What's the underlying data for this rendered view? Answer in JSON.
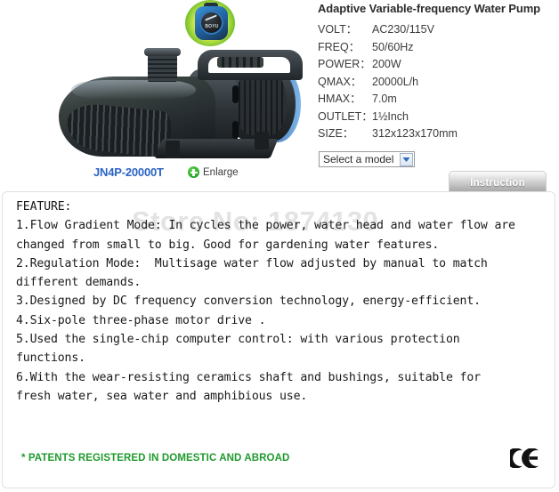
{
  "product": {
    "model": "JN4P-20000T",
    "enlarge_label": "Enlarge",
    "enlarge_icon": "plus-circle-icon",
    "image_alt": "black-water-pump-with-blue-accents",
    "badge_logo": "BOYU"
  },
  "specs": {
    "title": "Adaptive Variable-frequency Water Pump",
    "rows": [
      {
        "key": "VOLT：",
        "value": "AC230/115V"
      },
      {
        "key": "FREQ：",
        "value": "50/60Hz"
      },
      {
        "key": "POWER：",
        "value": "200W"
      },
      {
        "key": "QMAX：",
        "value": "20000L/h"
      },
      {
        "key": "HMAX：",
        "value": "7.0m"
      },
      {
        "key": "OUTLET：",
        "value": "1½Inch"
      },
      {
        "key": "SIZE：",
        "value": "312x123x170mm"
      }
    ]
  },
  "model_select": {
    "value": "Select a model",
    "arrow_icon": "chevron-down-icon",
    "options": [
      "Select a model"
    ]
  },
  "tabs": [
    {
      "label": "Instruction",
      "active": true
    }
  ],
  "panel": {
    "watermark": "Store No: 1874130",
    "feature_text": "FEATURE:\n1.Flow Gradient Mode: In cycles the power, water head and water flow are\nchanged from small to big. Good for gardening water features.\n2.Regulation Mode:  Multisage water flow adjusted by manual to match\ndifferent demands.\n3.Designed by DC frequency conversion technology, energy-efficient.\n4.Six-pole three-phase motor drive .\n5.Used the single-chip computer control: with various protection\nfunctions.\n6.With the wear-resisting ceramics shaft and bushings, suitable for\nfresh water, sea water and amphibious use.",
    "patents_note": "* PATENTS REGISTERED IN DOMESTIC AND ABROAD",
    "ce_mark": "ce-mark-icon"
  },
  "colors": {
    "model_blue": "#2b63c6",
    "patents_green": "#1f9b2e",
    "enlarge_green": "#23a62a",
    "watermark_gray": "#e3e3e3",
    "panel_border": "#e0e0e0",
    "tab_text": "#ffffff"
  }
}
